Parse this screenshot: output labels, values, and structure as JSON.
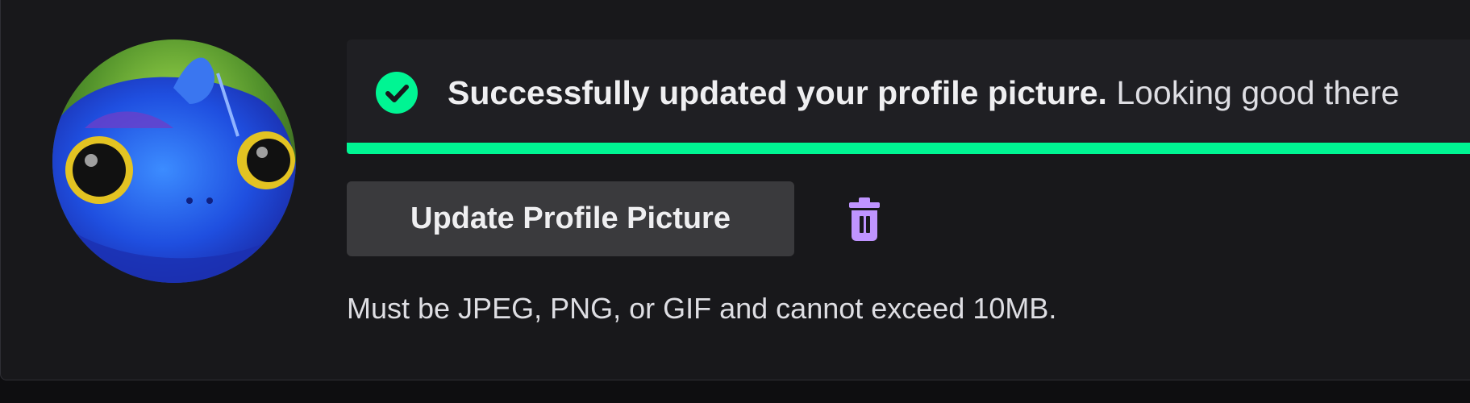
{
  "profile_picture": {
    "avatar_alt": "Profile picture (blue creature)",
    "colors": {
      "accent_green": "#00f593",
      "trash_purple": "#bf94ff",
      "panel_bg": "#18181b"
    }
  },
  "toast": {
    "icon": "check-circle-icon",
    "title": "Successfully updated your profile picture.",
    "message": "Looking good there"
  },
  "actions": {
    "update_label": "Update Profile Picture",
    "delete_icon": "trash-icon"
  },
  "hint": "Must be JPEG, PNG, or GIF and cannot exceed 10MB."
}
